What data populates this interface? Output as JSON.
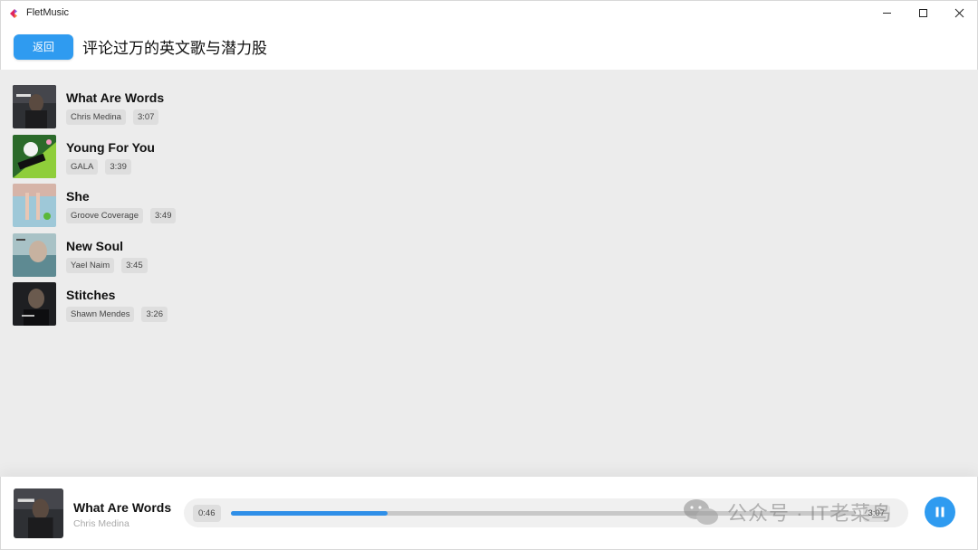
{
  "window": {
    "title": "FletMusic"
  },
  "header": {
    "back_label": "返回",
    "title": "评论过万的英文歌与潜力股"
  },
  "songs": [
    {
      "title": "What Are Words",
      "artist": "Chris Medina",
      "duration": "3:07"
    },
    {
      "title": "Young For You",
      "artist": "GALA",
      "duration": "3:39"
    },
    {
      "title": "She",
      "artist": "Groove Coverage",
      "duration": "3:49"
    },
    {
      "title": "New Soul",
      "artist": "Yael Naim",
      "duration": "3:45"
    },
    {
      "title": "Stitches",
      "artist": "Shawn Mendes",
      "duration": "3:26"
    }
  ],
  "player": {
    "title": "What Are Words",
    "artist": "Chris Medina",
    "current_time": "0:46",
    "total_time": "3:07",
    "progress": 0.25
  },
  "watermark": {
    "text": "公众号 · IT老菜鸟"
  },
  "colors": {
    "accent": "#2f9bf0",
    "progress": "#2f8fe8",
    "background": "#ececec"
  },
  "icons": {
    "app": "flet-logo-icon",
    "minimize": "minimize-icon",
    "maximize": "maximize-icon",
    "close": "close-icon",
    "pause": "pause-icon",
    "watermark": "wechat-icon"
  }
}
